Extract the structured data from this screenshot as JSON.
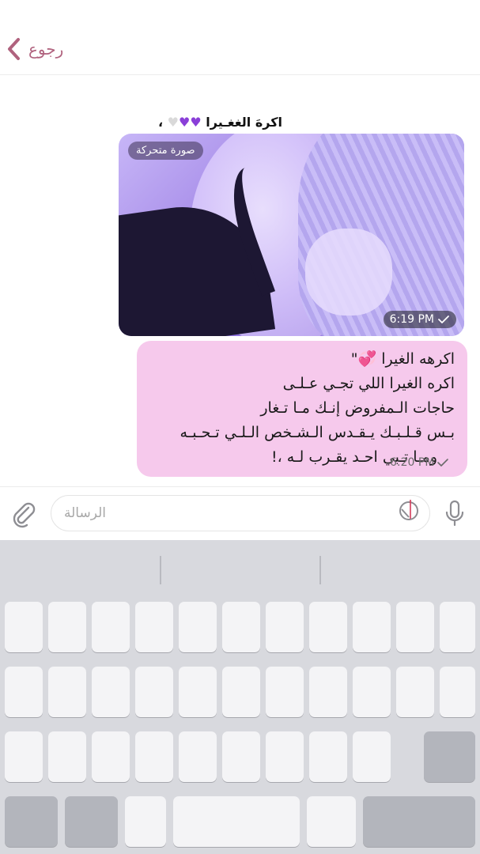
{
  "header": {
    "back_label": "رجوع"
  },
  "chat": {
    "caption": {
      "text": "اكرهَ الغغـيرا",
      "hearts": [
        "purple-heart",
        "purple-heart",
        "white-heart"
      ],
      "suffix": "،"
    },
    "gif": {
      "badge": "صورة متحركة",
      "time": "6:19 PM"
    },
    "message": {
      "lines": [
        "اكرهه الغيرا 💞\"",
        "اكره الغيرا اللي تجـي عـلـى",
        "حاجات الـمفروض إنـك مـا تـغار",
        "بـس قـلـبـك يـقـدس الـشـخص الـلـي تـحـبـه",
        "ومـا تـبي احـد يقـرب لـه  ،!"
      ],
      "time": "6:20 PM"
    }
  },
  "input": {
    "placeholder": "الرسالة"
  },
  "colors": {
    "accent": "#b0627e",
    "bubble": "#f6c9ec",
    "keyboard_bg": "#d8d9de",
    "key": "#f4f4f6"
  }
}
